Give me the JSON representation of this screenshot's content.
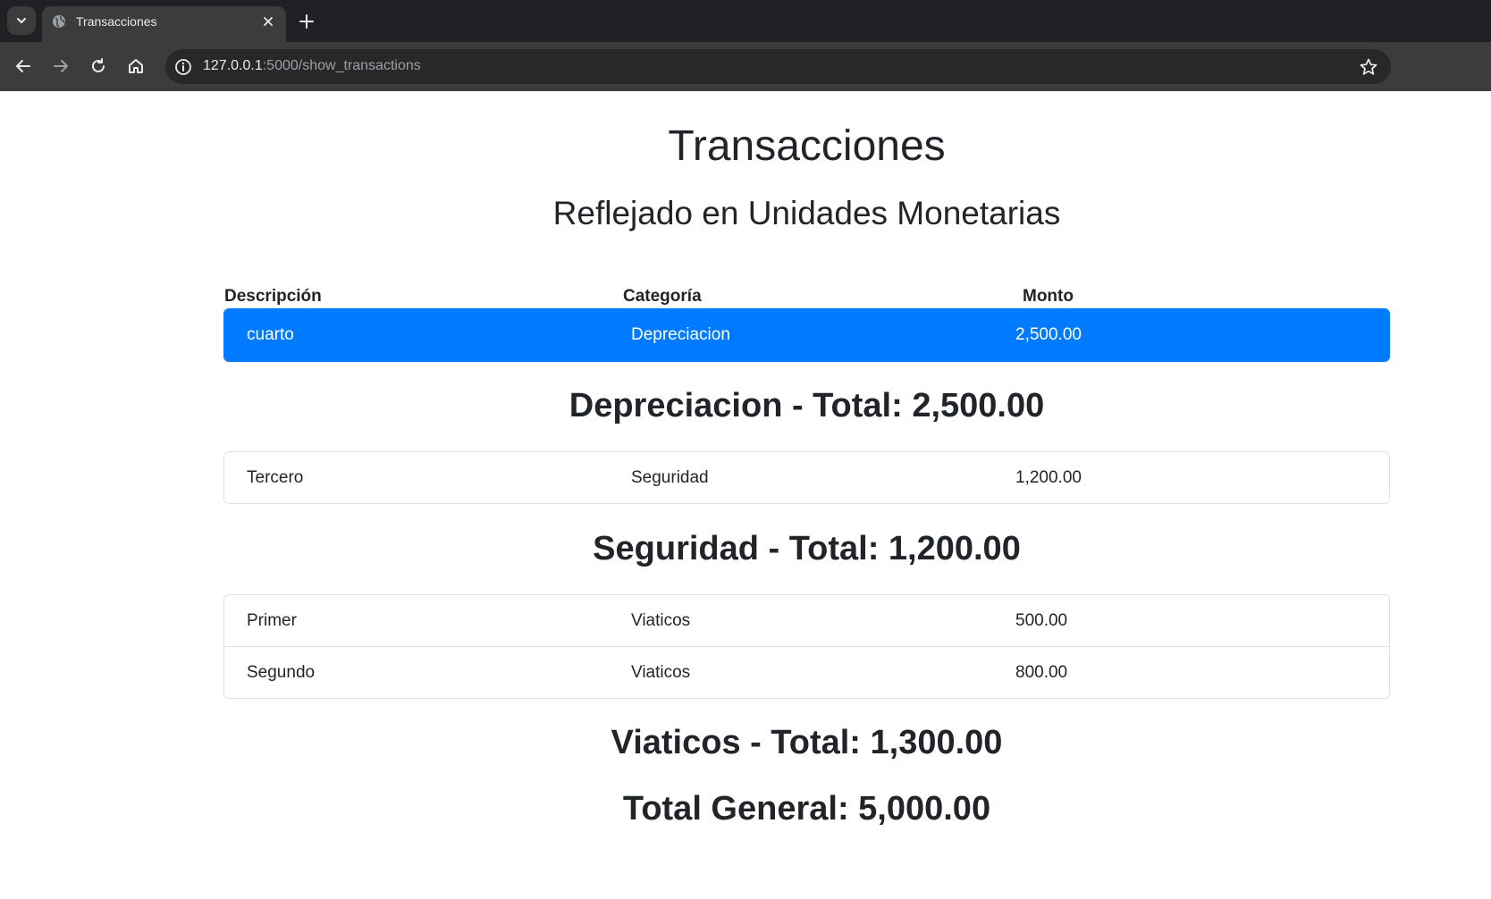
{
  "browser": {
    "tab_title": "Transacciones",
    "url_host": "127.0.0.1",
    "url_path": ":5000/show_transactions"
  },
  "page": {
    "title": "Transacciones",
    "subtitle": "Reflejado en Unidades Monetarias",
    "headers": {
      "description": "Descripción",
      "category": "Categoría",
      "amount": "Monto"
    },
    "groups": [
      {
        "rows": [
          {
            "description": "cuarto",
            "category": "Depreciacion",
            "amount": "2,500.00",
            "active": true
          }
        ],
        "total_label": "Depreciacion - Total: 2,500.00"
      },
      {
        "rows": [
          {
            "description": "Tercero",
            "category": "Seguridad",
            "amount": "1,200.00"
          }
        ],
        "total_label": "Seguridad - Total: 1,200.00"
      },
      {
        "rows": [
          {
            "description": "Primer",
            "category": "Viaticos",
            "amount": "500.00"
          },
          {
            "description": "Segundo",
            "category": "Viaticos",
            "amount": "800.00"
          }
        ],
        "total_label": "Viaticos - Total: 1,300.00"
      }
    ],
    "grand_total": "Total General: 5,000.00"
  },
  "colors": {
    "active_row": "#007bff",
    "text": "#212529",
    "border": "#dee2e6"
  }
}
